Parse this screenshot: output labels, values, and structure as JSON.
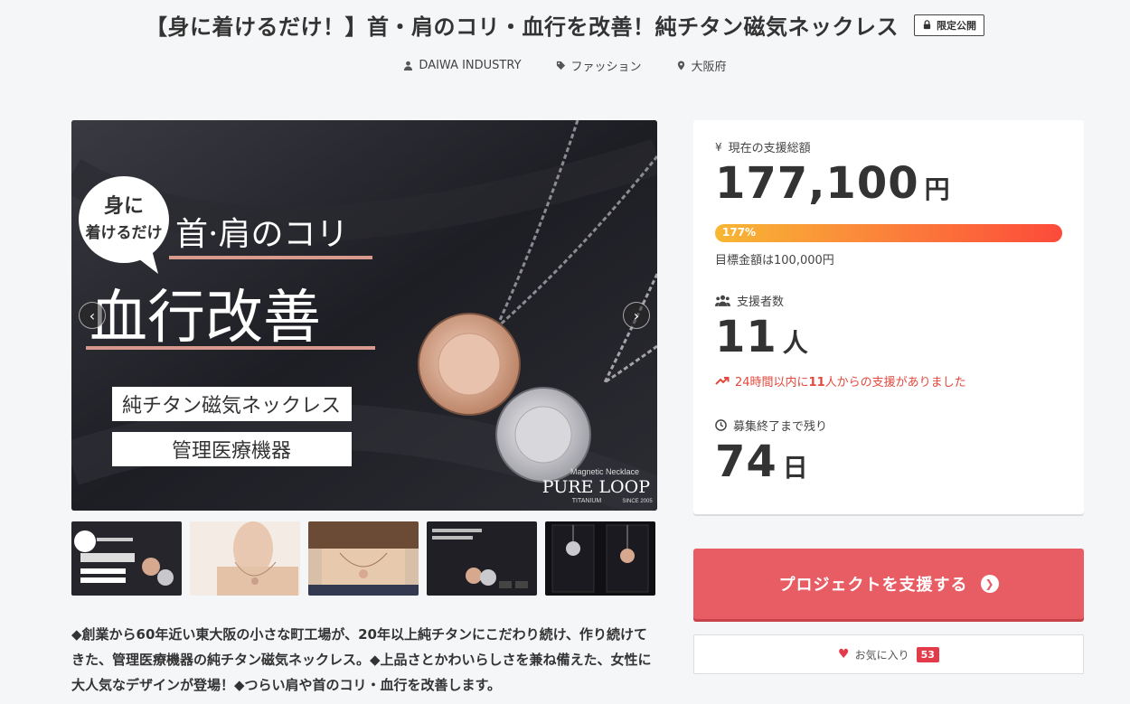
{
  "header": {
    "title": "【身に着けるだけ！】首・肩のコリ・血行を改善！純チタン磁気ネックレス",
    "badge": "限定公開"
  },
  "meta": {
    "owner": "DAIWA INDUSTRY",
    "category": "ファッション",
    "location": "大阪府"
  },
  "hero": {
    "bubble_line1": "身に",
    "bubble_line2": "着けるだけ",
    "headline": "首·肩のコリ",
    "main_copy": "血行改善",
    "product_label": "純チタン磁気ネックレス",
    "device_label": "管理医療機器",
    "brand_small": "Magnetic Necklace",
    "brand_logo": "PURE LOOP",
    "brand_sub": "TITANIUM",
    "brand_since": "SINCE 2005"
  },
  "thumbnails": [
    {
      "name": "thumb-main-visual"
    },
    {
      "name": "thumb-model-neck"
    },
    {
      "name": "thumb-model-pendant"
    },
    {
      "name": "thumb-product-dark"
    },
    {
      "name": "thumb-product-packages"
    }
  ],
  "description": "◆創業から60年近い東大阪の小さな町工場が、20年以上純チタンにこだわり続け、作り続けてきた、管理医療機器の純チタン磁気ネックレス。◆上品さとかわいらしさを兼ね備えた、女性に大人気なデザインが登場！◆つらい肩や首のコリ・血行を改善します。",
  "stats": {
    "total_label": "現在の支援総額",
    "total_value": "177,100",
    "total_unit": "円",
    "progress_percent": 177,
    "progress_label": "177%",
    "goal_text": "目標金額は100,000円",
    "supporters_label": "支援者数",
    "supporters_value": "11",
    "supporters_unit": "人",
    "trend_prefix": "24時間以内に",
    "trend_count": "11",
    "trend_suffix": "人からの支援がありました",
    "remaining_label": "募集終了まで残り",
    "remaining_value": "74",
    "remaining_unit": "日"
  },
  "actions": {
    "support_label": "プロジェクトを支援する",
    "favorite_label": "お気に入り",
    "favorite_count": "53"
  },
  "colors": {
    "accent_red": "#e85c63",
    "trend_red": "#e4483c",
    "progress_start": "#f7b733",
    "progress_end": "#fc4a3a"
  }
}
